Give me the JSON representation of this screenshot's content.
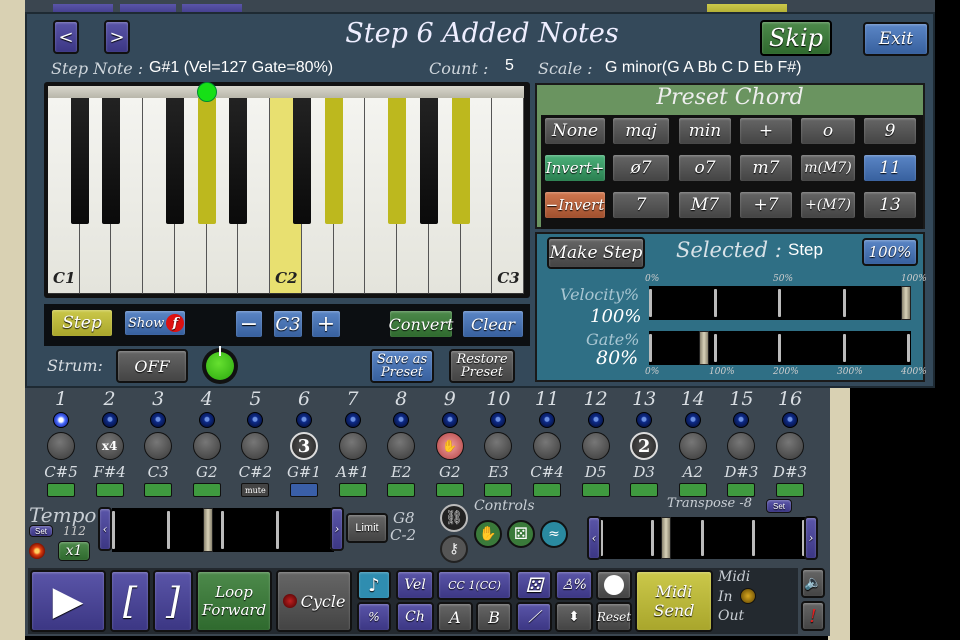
{
  "dialog": {
    "title": "Step 6 Added Notes",
    "skip_label": "Skip",
    "exit_label": "Exit",
    "prev_label": "<",
    "next_label": ">",
    "step_note_label": "Step Note :",
    "step_note_value": "G#1 (Vel=127 Gate=80%)",
    "count_label": "Count :",
    "count_value": "5",
    "scale_label": "Scale :",
    "scale_value": "G minor(G A Bb C D Eb F#)"
  },
  "piano": {
    "white_keys": [
      "C1",
      "D1",
      "E1",
      "F1",
      "G1",
      "A1",
      "B1",
      "C2",
      "D2",
      "E2",
      "F2",
      "G2",
      "A2",
      "B2",
      "C3"
    ],
    "labels": {
      "C1": "C1",
      "C2": "C2",
      "C3": "C3"
    },
    "highlighted": [
      "G#1",
      "C2",
      "D#2",
      "F#2",
      "A#2"
    ],
    "step_note_marker": "G#1",
    "highlight_color": "#bdb81e",
    "marker_color": "#16e016"
  },
  "piano_controls": {
    "step_label": "Step",
    "show_label": "Show",
    "show_badge": "f",
    "minus_label": "−",
    "octave_label": "C3",
    "plus_label": "+",
    "convert_label": "Convert",
    "clear_label": "Clear",
    "strum_label": "Strum:",
    "strum_value": "OFF",
    "save_preset_label": "Save as Preset",
    "restore_preset_label": "Restore Preset"
  },
  "preset_chord": {
    "title": "Preset Chord",
    "rows": [
      [
        "None",
        "maj",
        "min",
        "+",
        "o",
        "9"
      ],
      [
        "Invert+",
        "ø7",
        "o7",
        "m7",
        "m(M7)",
        "11"
      ],
      [
        "−Invert",
        "7",
        "M7",
        "+7",
        "+(M7)",
        "13"
      ]
    ],
    "selected": "11"
  },
  "selection": {
    "make_step_label": "Make Step",
    "selected_label": "Selected :",
    "selected_value": "Step",
    "percent_button": "100%",
    "velocity_label": "Velocity%",
    "velocity_value": "100%",
    "velocity_percent": 100,
    "velocity_ticks": [
      "0%",
      "50%",
      "100%"
    ],
    "gate_label": "Gate%",
    "gate_value": "80%",
    "gate_percent": 80,
    "gate_ticks": [
      "0%",
      "100%",
      "200%",
      "300%",
      "400%"
    ]
  },
  "steps": [
    {
      "num": "1",
      "note": "C#5",
      "knob": "",
      "box": "on",
      "led": "active"
    },
    {
      "num": "2",
      "note": "F#4",
      "knob": "x4",
      "box": "on"
    },
    {
      "num": "3",
      "note": "C3",
      "knob": "",
      "box": "on"
    },
    {
      "num": "4",
      "note": "G2",
      "knob": "",
      "box": "on"
    },
    {
      "num": "5",
      "note": "C#2",
      "knob": "",
      "box": "mute"
    },
    {
      "num": "6",
      "note": "G#1",
      "knob": "3",
      "box": "selected"
    },
    {
      "num": "7",
      "note": "A#1",
      "knob": "",
      "box": "on"
    },
    {
      "num": "8",
      "note": "E2",
      "knob": "",
      "box": "on"
    },
    {
      "num": "9",
      "note": "G2",
      "knob": "hand",
      "box": "on"
    },
    {
      "num": "10",
      "note": "E3",
      "knob": "",
      "box": "on"
    },
    {
      "num": "11",
      "note": "C#4",
      "knob": "",
      "box": "on"
    },
    {
      "num": "12",
      "note": "D5",
      "knob": "",
      "box": "on"
    },
    {
      "num": "13",
      "note": "D3",
      "knob": "2",
      "box": "on"
    },
    {
      "num": "14",
      "note": "A2",
      "knob": "",
      "box": "on"
    },
    {
      "num": "15",
      "note": "D#3",
      "knob": "",
      "box": "on"
    },
    {
      "num": "16",
      "note": "D#3",
      "knob": "",
      "box": "on"
    }
  ],
  "mute_label": "mute",
  "tempo": {
    "label": "Tempo",
    "set_label": "Set",
    "value": "112",
    "multiplier": "x1",
    "limit_label": "Limit",
    "range_high": "G8",
    "range_low": "C-2"
  },
  "controls": {
    "label": "Controls"
  },
  "transpose": {
    "label": "Transpose -8",
    "set_label": "Set"
  },
  "transport": {
    "loop_label": "Loop Forward",
    "cycle_label": "Cycle",
    "vel_label": "Vel",
    "ch_label": "Ch",
    "cc_label": "CC 1(CC)",
    "a_label": "A",
    "b_label": "B",
    "reset_label": "Reset",
    "pct_label": "%",
    "midi_send_label": "Midi Send",
    "midi_label": "Midi",
    "in_label": "In",
    "out_label": "Out"
  }
}
